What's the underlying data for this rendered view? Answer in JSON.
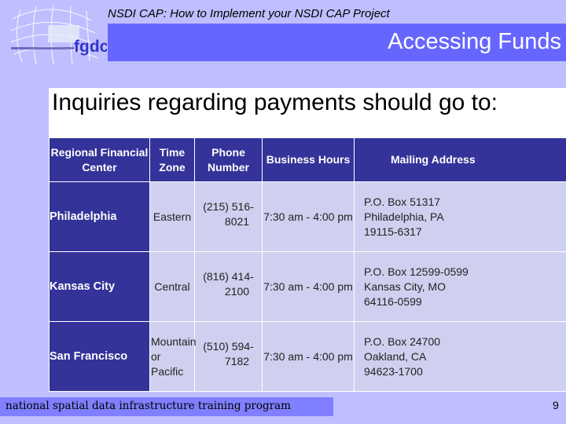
{
  "header": {
    "logo_text": "fgdc",
    "subtitle": "NSDI CAP: How to Implement your NSDI CAP Project",
    "title": "Accessing Funds"
  },
  "main": {
    "heading": "Inquiries regarding payments should go to:",
    "table": {
      "columns": [
        "Regional Financial Center",
        "Time Zone",
        "Phone Number",
        "Business Hours",
        "Mailing Address"
      ],
      "rows": [
        {
          "center": "Philadelphia",
          "time_zone": "Eastern",
          "phone_line1": "(215) 516-",
          "phone_line2": "8021",
          "hours": "7:30 am - 4:00 pm",
          "address_line1": "P.O. Box 51317",
          "address_line2": "Philadelphia, PA",
          "address_line3": "19115-6317"
        },
        {
          "center": "Kansas City",
          "time_zone": "Central",
          "phone_line1": "(816) 414-",
          "phone_line2": "2100",
          "hours": "7:30 am - 4:00 pm",
          "address_line1": "P.O. Box 12599-0599",
          "address_line2": "Kansas City, MO",
          "address_line3": "64116-0599"
        },
        {
          "center": "San Francisco",
          "time_zone_line1": "Mountain",
          "time_zone_line2": "or Pacific",
          "phone_line1": "(510) 594-",
          "phone_line2": "7182",
          "hours": "7:30 am - 4:00 pm",
          "address_line1": "P.O. Box 24700",
          "address_line2": "Oakland, CA",
          "address_line3": "94623-1700"
        }
      ]
    }
  },
  "footer": {
    "program": "national spatial data infrastructure training program",
    "page_number": "9"
  },
  "colors": {
    "background": "#BFBFFF",
    "title_bar": "#6666FF",
    "table_header": "#333399",
    "table_cell": "#CFD0EF",
    "footer_bar": "#7F7FFF"
  }
}
